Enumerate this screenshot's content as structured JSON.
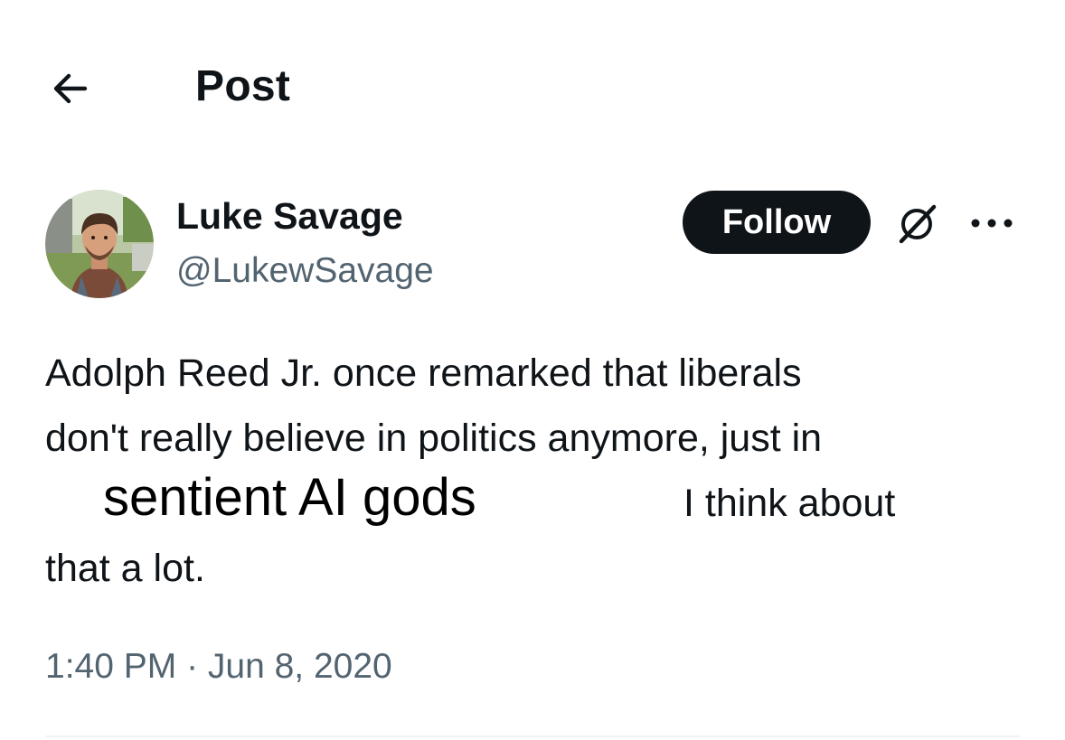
{
  "header": {
    "back_icon": "arrow-left-icon",
    "title": "Post"
  },
  "author": {
    "name": "Luke Savage",
    "handle": "@LukewSavage",
    "avatar": "profile-photo"
  },
  "actions": {
    "follow_label": "Follow",
    "grok_icon": "grok-icon",
    "more_icon": "more-horizontal-icon"
  },
  "tweet": {
    "line1": "Adolph Reed Jr. once remarked that liberals",
    "line2": "don't really believe in politics anymore, just in",
    "overlay": "sentient AI gods",
    "line3": "I think about",
    "line4": "that a lot."
  },
  "meta": {
    "timestamp": "1:40 PM · Jun 8, 2020"
  },
  "colors": {
    "text_primary": "#0f1419",
    "text_secondary": "#536471",
    "button_bg": "#0f1419",
    "button_text": "#ffffff",
    "divider": "#eff3f4"
  }
}
